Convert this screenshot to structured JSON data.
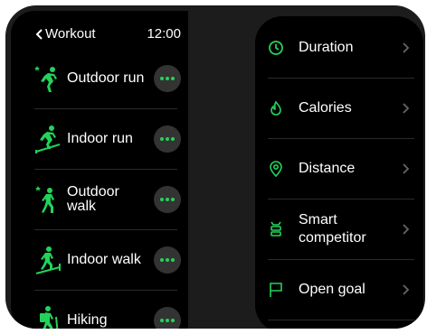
{
  "colors": {
    "accent": "#22d35a",
    "background": "#000000",
    "frame": "#1c1c1c"
  },
  "left_screen": {
    "header": {
      "back_label": "Workout",
      "time": "12:00"
    },
    "workouts": [
      {
        "label": "Outdoor run",
        "icon": "outdoor-run-icon"
      },
      {
        "label": "Indoor run",
        "icon": "indoor-run-icon"
      },
      {
        "label": "Outdoor walk",
        "icon": "outdoor-walk-icon"
      },
      {
        "label": "Indoor walk",
        "icon": "indoor-walk-icon"
      },
      {
        "label": "Hiking",
        "icon": "hiking-icon"
      }
    ]
  },
  "right_screen": {
    "goals": [
      {
        "label": "Duration",
        "icon": "clock-icon"
      },
      {
        "label": "Calories",
        "icon": "flame-icon"
      },
      {
        "label": "Distance",
        "icon": "location-pin-icon"
      },
      {
        "label": "Smart competitor",
        "icon": "competitor-icon"
      },
      {
        "label": "Open goal",
        "icon": "flag-icon"
      }
    ]
  }
}
